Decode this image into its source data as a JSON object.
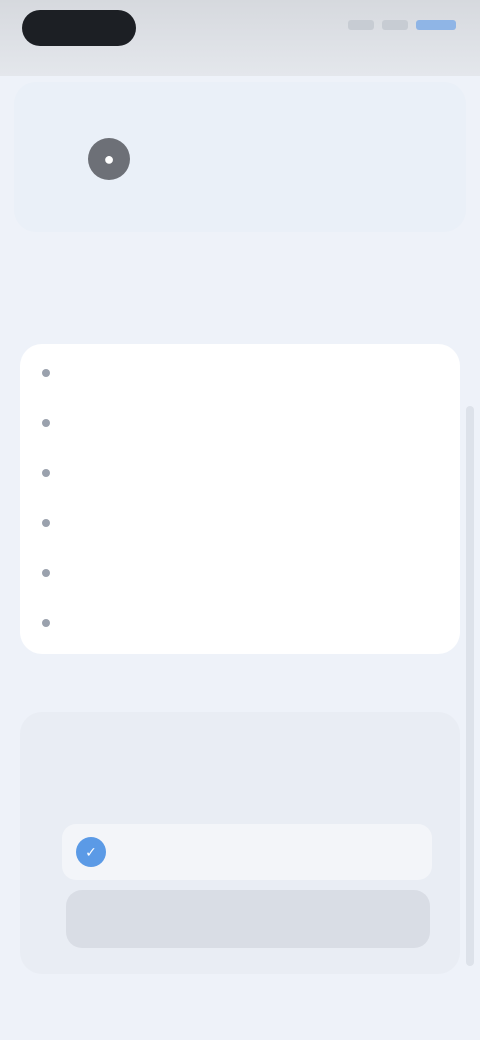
{
  "status_bar": {
    "time": "",
    "indicators": [
      "signal-icon",
      "wifi-icon",
      "battery-icon"
    ],
    "accent_color": "#8fb5e6"
  },
  "profile": {
    "avatar_icon": "user-icon",
    "name": "",
    "link": "",
    "meta": ""
  },
  "section": {
    "title": "",
    "subtitle": ""
  },
  "list": {
    "items": [
      {
        "label": ""
      },
      {
        "label": ""
      },
      {
        "label": ""
      },
      {
        "label": ""
      },
      {
        "label": ""
      },
      {
        "label": ""
      }
    ]
  },
  "bottom": {
    "label": "",
    "tab_left": "",
    "tab_center": "",
    "inner_label": "",
    "option_label": "",
    "option_icon": "check-icon"
  },
  "colors": {
    "accent": "#5b9ae6",
    "background": "#eef2f9"
  }
}
